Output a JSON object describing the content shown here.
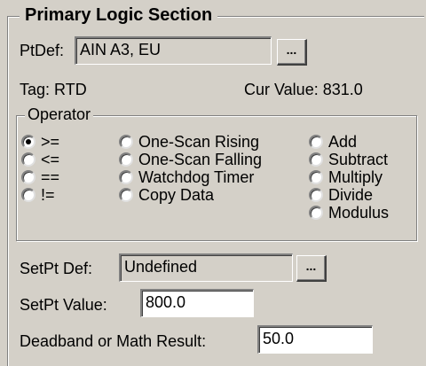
{
  "primary": {
    "title": "Primary Logic Section"
  },
  "ptdef": {
    "label": "PtDef:",
    "value": "AIN A3, EU",
    "browse_label": "..."
  },
  "tag": {
    "label": "Tag: RTD"
  },
  "cur_value": {
    "label": "Cur Value: 831.0"
  },
  "operator": {
    "title": "Operator",
    "col1": [
      {
        "label": ">=",
        "selected": true
      },
      {
        "label": "<=",
        "selected": false
      },
      {
        "label": "==",
        "selected": false
      },
      {
        "label": "!=",
        "selected": false
      }
    ],
    "col2": [
      {
        "label": "One-Scan Rising",
        "selected": false
      },
      {
        "label": "One-Scan Falling",
        "selected": false
      },
      {
        "label": "Watchdog Timer",
        "selected": false
      },
      {
        "label": "Copy Data",
        "selected": false
      }
    ],
    "col3": [
      {
        "label": "Add",
        "selected": false
      },
      {
        "label": "Subtract",
        "selected": false
      },
      {
        "label": "Multiply",
        "selected": false
      },
      {
        "label": "Divide",
        "selected": false
      },
      {
        "label": "Modulus",
        "selected": false
      }
    ]
  },
  "setpt_def": {
    "label": "SetPt Def:",
    "value": "Undefined",
    "browse_label": "..."
  },
  "setpt_value": {
    "label": "SetPt Value:",
    "value": "800.0"
  },
  "deadband": {
    "label": "Deadband or Math Result:",
    "value": "50.0"
  }
}
